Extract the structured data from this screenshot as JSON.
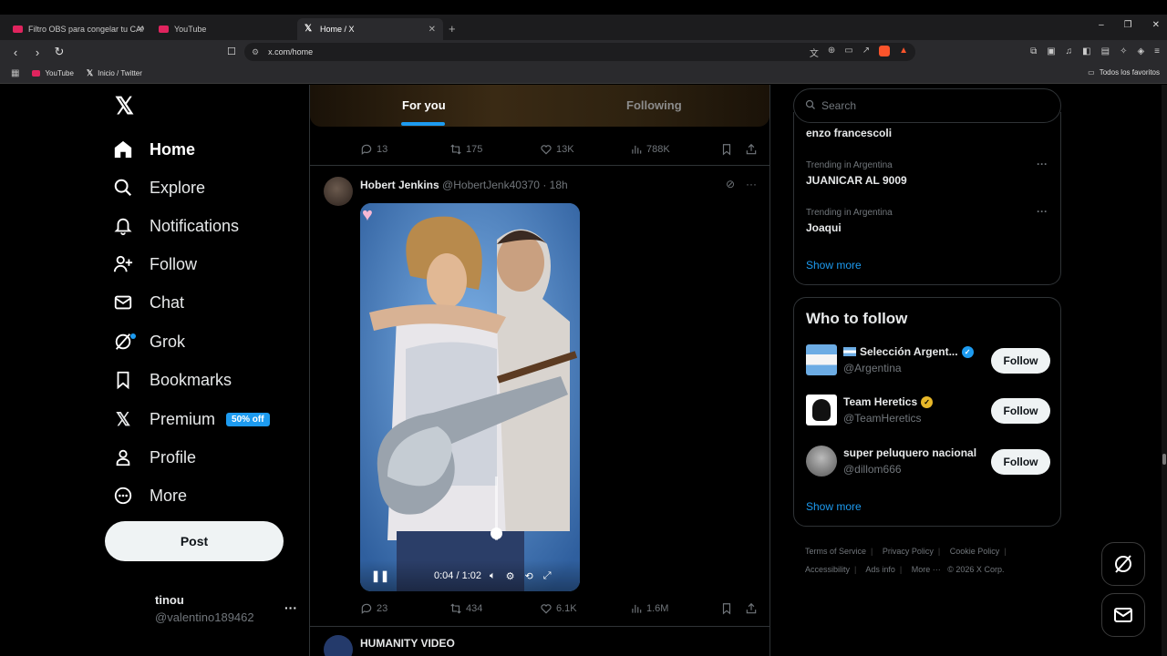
{
  "browser": {
    "tabs": [
      {
        "label": "Filtro OBS para congelar tu CAM en",
        "icon": "youtube-icon"
      },
      {
        "label": "YouTube",
        "icon": "youtube-icon"
      },
      {
        "label": "Home / X",
        "icon": "x-icon"
      }
    ],
    "url": "x.com/home",
    "bookmarks": [
      {
        "label": "YouTube",
        "icon": "youtube-icon"
      },
      {
        "label": "Inicio / Twitter",
        "icon": "x-icon"
      }
    ],
    "favorites_label": "Todos los favoritos",
    "shield_badge": "1"
  },
  "nav": {
    "items": [
      {
        "label": "Home",
        "icon": "home-icon"
      },
      {
        "label": "Explore",
        "icon": "search-icon"
      },
      {
        "label": "Notifications",
        "icon": "bell-icon"
      },
      {
        "label": "Follow",
        "icon": "person-add-icon"
      },
      {
        "label": "Chat",
        "icon": "mail-icon"
      },
      {
        "label": "Grok",
        "icon": "grok-icon"
      },
      {
        "label": "Bookmarks",
        "icon": "bookmark-icon"
      },
      {
        "label": "Premium",
        "icon": "x-icon"
      },
      {
        "label": "Profile",
        "icon": "person-icon"
      },
      {
        "label": "More",
        "icon": "more-circle-icon"
      }
    ],
    "premium_badge": "50% off",
    "post_label": "Post",
    "account": {
      "name": "tinou",
      "handle": "@valentino189462"
    }
  },
  "feed": {
    "tabs": [
      {
        "label": "For you"
      },
      {
        "label": "Following"
      }
    ],
    "top_actions": {
      "replies": "13",
      "reposts": "175",
      "likes": "13K",
      "views": "788K"
    },
    "tweet": {
      "name": "Hobert Jenkins",
      "handle": "@HobertJenk40370",
      "time": "18h",
      "video_time": "0:04 / 1:02",
      "actions": {
        "replies": "23",
        "reposts": "434",
        "likes": "6.1K",
        "views": "1.6M"
      }
    },
    "next_tweet": {
      "name": "HUMANITY VIDEO"
    }
  },
  "sidebar": {
    "search_placeholder": "Search",
    "trends": [
      {
        "context": "",
        "title": "enzo francescoli"
      },
      {
        "context": "Trending in Argentina",
        "title": "JUANICAR AL 9009"
      },
      {
        "context": "Trending in Argentina",
        "title": "Joaqui"
      }
    ],
    "trends_show_more": "Show more",
    "who_to_follow": {
      "title": "Who to follow",
      "users": [
        {
          "name": "Selección Argent...",
          "handle": "@Argentina",
          "verified": "blue",
          "follow": "Follow"
        },
        {
          "name": "Team Heretics",
          "handle": "@TeamHeretics",
          "verified": "gold",
          "follow": "Follow"
        },
        {
          "name": "super peluquero nacional",
          "handle": "@dillom666",
          "verified": "",
          "follow": "Follow"
        }
      ],
      "show_more": "Show more"
    },
    "footer": [
      "Terms of Service",
      "Privacy Policy",
      "Cookie Policy",
      "Accessibility",
      "Ads info",
      "More ···",
      "© 2026 X Corp."
    ]
  },
  "colors": {
    "accent": "#1d9bf0",
    "background": "#000000",
    "text": "#e7e9ea",
    "muted": "#71767b",
    "gold": "#e8b829"
  }
}
